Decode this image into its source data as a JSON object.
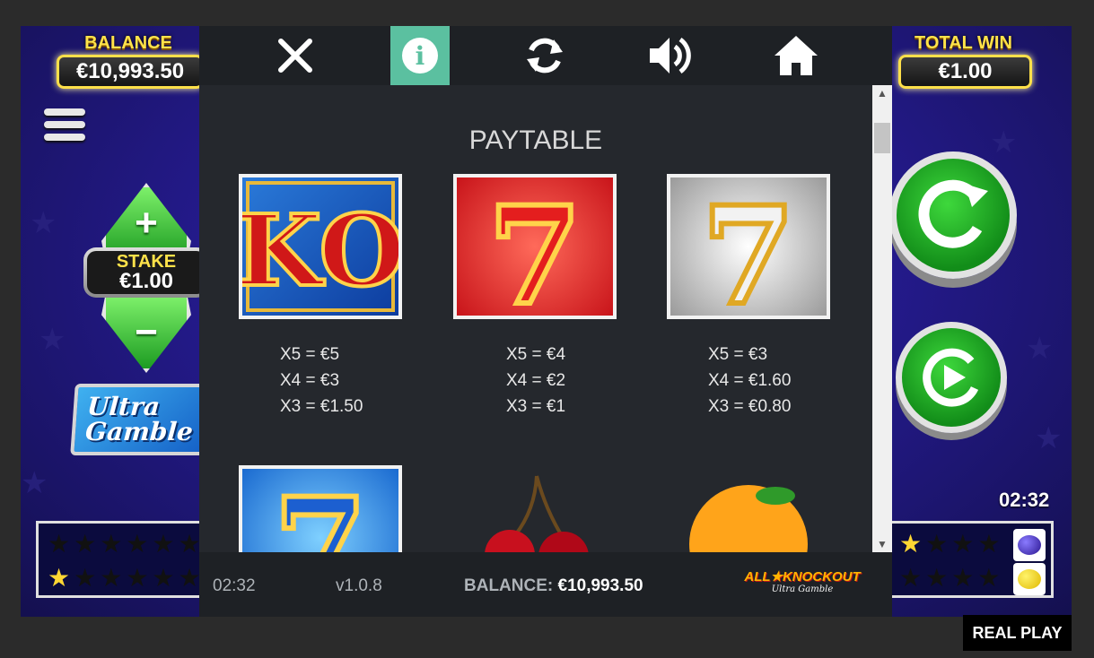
{
  "game": {
    "balance_label": "BALANCE",
    "balance_value": "€10,993.50",
    "total_win_label": "TOTAL WIN",
    "total_win_value": "€1.00",
    "stake_label": "STAKE",
    "stake_value": "€1.00",
    "stake_plus": "+",
    "stake_minus": "−",
    "ultra_gamble_line1": "Ultra",
    "ultra_gamble_line2": "Gamble",
    "clock": "02:32"
  },
  "toolbar": {
    "close_icon": "close-icon",
    "info_icon": "info-icon",
    "refresh_icon": "refresh-icon",
    "sound_icon": "speaker-icon",
    "home_icon": "home-icon",
    "info_glyph": "i",
    "active_color": "#5bc0a0"
  },
  "paytable": {
    "title": "PAYTABLE",
    "symbols": [
      {
        "name": "ko",
        "label": "KO",
        "pays": [
          "X5 = €5",
          "X4 = €3",
          "X3 = €1.50"
        ]
      },
      {
        "name": "red-seven",
        "label": "7",
        "pays": [
          "X5 = €4",
          "X4 = €2",
          "X3 = €1"
        ]
      },
      {
        "name": "silver-seven",
        "label": "7",
        "pays": [
          "X5 = €3",
          "X4 = €1.60",
          "X3 = €0.80"
        ]
      },
      {
        "name": "blue-seven",
        "label": "7"
      },
      {
        "name": "cherries"
      },
      {
        "name": "orange"
      }
    ]
  },
  "footer": {
    "time": "02:32",
    "version": "v1.0.8",
    "balance_label": "BALANCE:",
    "balance_value": "€10,993.50",
    "logo_line1": "ALL★KNOCKOUT",
    "logo_line2": "Ultra Gamble"
  },
  "real_play": "REAL PLAY"
}
